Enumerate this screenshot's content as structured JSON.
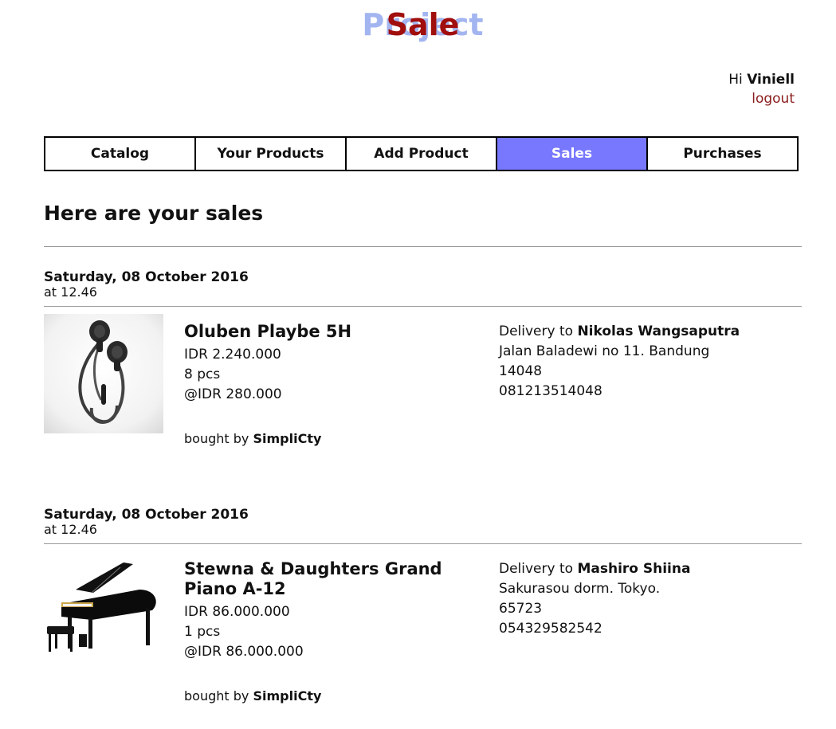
{
  "logo": {
    "part1": "Sale",
    "part2": "Project"
  },
  "user": {
    "greeting_prefix": "Hi",
    "username": "Viniell",
    "logout_label": "logout"
  },
  "nav": {
    "items": [
      {
        "label": "Catalog"
      },
      {
        "label": "Your Products"
      },
      {
        "label": "Add Product"
      },
      {
        "label": "Sales"
      },
      {
        "label": "Purchases"
      }
    ],
    "active_index": 3,
    "active_color": "#7878ff"
  },
  "page": {
    "title": "Here are your sales"
  },
  "sales": [
    {
      "date": "Saturday, 08 October 2016",
      "time": "at 12.46",
      "image_icon": "earphones-image",
      "product_name": "Oluben Playbe 5H",
      "total": "IDR 2.240.000",
      "quantity": "8 pcs",
      "unit_price": "@IDR 280.000",
      "bought_by_prefix": "bought by",
      "buyer": "SimpliCty",
      "delivery_prefix": "Delivery to",
      "recipient": "Nikolas Wangsaputra",
      "address": "Jalan Baladewi no 11. Bandung",
      "postal_code": "14048",
      "phone": "081213514048"
    },
    {
      "date": "Saturday, 08 October 2016",
      "time": "at 12.46",
      "image_icon": "grand-piano-image",
      "product_name": "Stewna & Daughters Grand Piano A-12",
      "total": "IDR 86.000.000",
      "quantity": "1 pcs",
      "unit_price": "@IDR 86.000.000",
      "bought_by_prefix": "bought by",
      "buyer": "SimpliCty",
      "delivery_prefix": "Delivery to",
      "recipient": "Mashiro Shiina",
      "address": "Sakurasou dorm. Tokyo.",
      "postal_code": "65723",
      "phone": "054329582542"
    }
  ],
  "colors": {
    "logo_sale": "#a10e0e",
    "logo_project": "#a3b5f0",
    "logout": "#8b1c1c",
    "divider": "#9a9a9a"
  }
}
